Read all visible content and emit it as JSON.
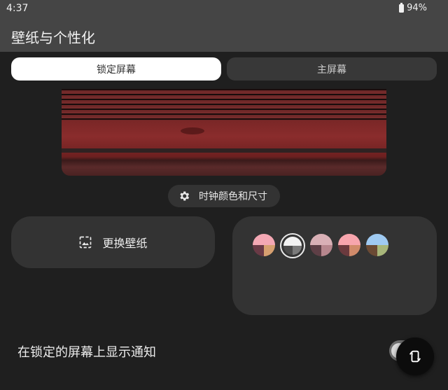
{
  "status": {
    "time": "4:37",
    "battery": "94%"
  },
  "appbar": {
    "title": "壁纸与个性化"
  },
  "tabs": [
    {
      "label": "锁定屏幕",
      "selected": true
    },
    {
      "label": "主屏幕",
      "selected": false
    }
  ],
  "clock_button": {
    "label": "时钟颜色和尺寸",
    "icon": "gear-icon"
  },
  "change_wallpaper": {
    "label": "更换壁纸",
    "icon": "image-icon"
  },
  "color_options": [
    {
      "colors": [
        "#f4a8b4",
        "#6a3a46",
        "#d7a070"
      ],
      "selected": false
    },
    {
      "colors": [
        "#f2f2f2",
        "#4a4a4a",
        "#7a7a7a"
      ],
      "selected": true
    },
    {
      "colors": [
        "#d9b0b6",
        "#5e3f46",
        "#b7878e"
      ],
      "selected": false
    },
    {
      "colors": [
        "#f7a5ad",
        "#6b3a3e",
        "#d08a6a"
      ],
      "selected": false
    },
    {
      "colors": [
        "#9fcaf2",
        "#6b4a34",
        "#a8b67a"
      ],
      "selected": false
    }
  ],
  "lock_notifications": {
    "label": "在锁定的屏幕上显示通知",
    "enabled": false
  },
  "colors": {
    "background": "#1f1f1f",
    "surface": "#333333",
    "appbar": "#454545"
  }
}
